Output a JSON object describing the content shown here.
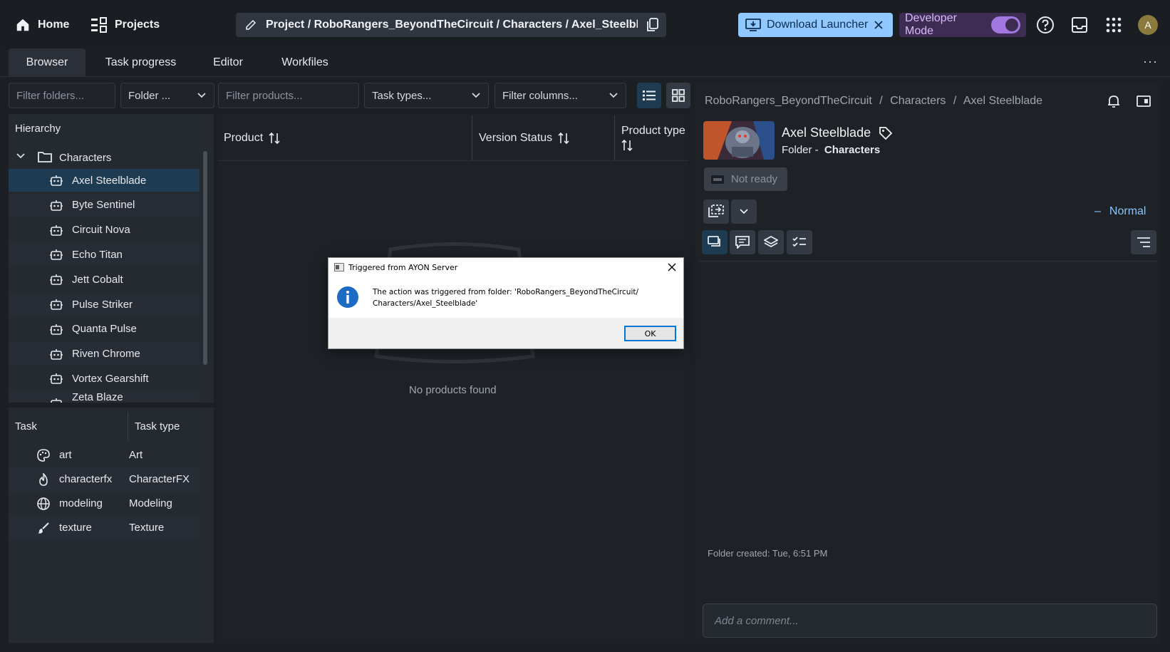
{
  "topbar": {
    "home": "Home",
    "projects": "Projects",
    "breadcrumb": "Project / RoboRangers_BeyondTheCircuit / Characters / Axel_Steelblade",
    "download_launcher": "Download Launcher",
    "developer_mode": "Developer Mode",
    "avatar_initial": "A"
  },
  "tabs": [
    "Browser",
    "Task progress",
    "Editor",
    "Workfiles"
  ],
  "filters": {
    "folders_placeholder": "Filter folders...",
    "folder_select": "Folder ...",
    "products_placeholder": "Filter products...",
    "task_types": "Task types...",
    "columns": "Filter columns..."
  },
  "hierarchy": {
    "title": "Hierarchy",
    "root": "Characters",
    "items": [
      "Axel Steelblade",
      "Byte Sentinel",
      "Circuit Nova",
      "Echo Titan",
      "Jett Cobalt",
      "Pulse Striker",
      "Quanta Pulse",
      "Riven Chrome",
      "Vortex Gearshift",
      "Zeta Blaze"
    ]
  },
  "tasks": {
    "col_task": "Task",
    "col_type": "Task type",
    "rows": [
      {
        "name": "art",
        "type": "Art",
        "icon": "palette-icon"
      },
      {
        "name": "characterfx",
        "type": "CharacterFX",
        "icon": "fire-icon"
      },
      {
        "name": "modeling",
        "type": "Modeling",
        "icon": "globe-icon"
      },
      {
        "name": "texture",
        "type": "Texture",
        "icon": "brush-icon"
      }
    ]
  },
  "products": {
    "col_product": "Product",
    "col_version_status": "Version Status",
    "col_product_type": "Product type",
    "empty": "No products found"
  },
  "details": {
    "breadcrumb": [
      "RoboRangers_BeyondTheCircuit",
      "Characters",
      "Axel Steelblade"
    ],
    "title": "Axel Steelblade",
    "subtitle_prefix": "Folder -",
    "subtitle_value": "Characters",
    "status": "Not ready",
    "priority": "Normal",
    "folder_created": "Folder created: Tue, 6:51 PM",
    "comment_placeholder": "Add a comment..."
  },
  "dialog": {
    "title": "Triggered from AYON Server",
    "message": "The action was triggered from folder: 'RoboRangers_BeyondTheCircuit/ Characters/Axel_Steelblade'",
    "ok": "OK"
  },
  "colors": {
    "accent": "#90c8ff",
    "selected": "#1f3b52",
    "dev_mode": "#a277e0"
  }
}
